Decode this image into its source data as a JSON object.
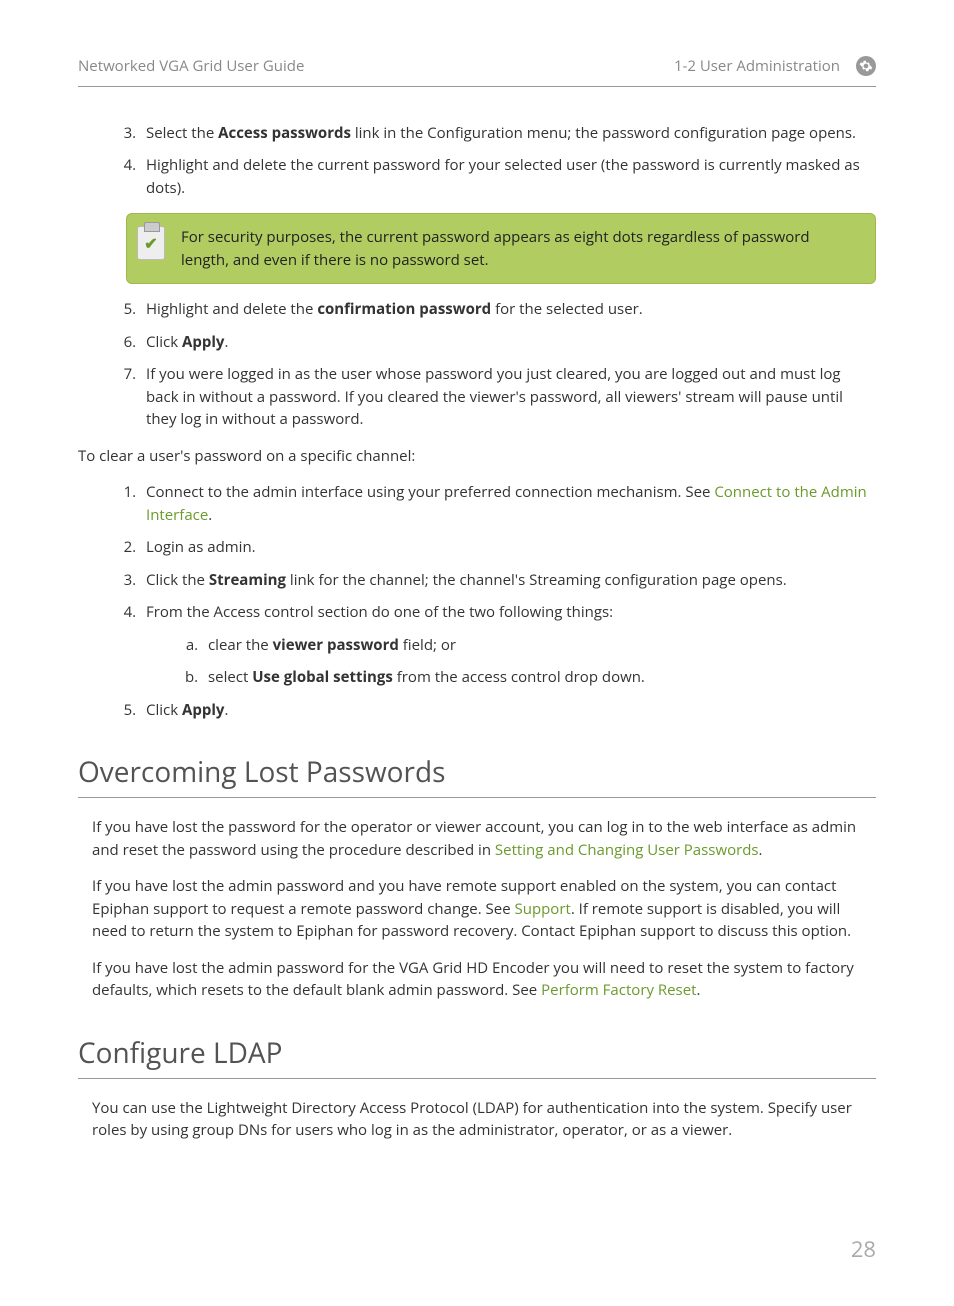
{
  "header": {
    "left": "Networked VGA Grid User Guide",
    "right": "1-2 User Administration"
  },
  "list1": {
    "item3_a": "Select the ",
    "item3_bold": "Access passwords",
    "item3_b": " link in the Configuration menu; the password configuration page opens.",
    "item4": "Highlight and delete the current password for your selected user (the password is currently masked as dots)."
  },
  "callout1": "For security purposes, the current password appears as eight dots regardless of password length, and even if there is no password set.",
  "list2": {
    "item5_a": "Highlight and delete the ",
    "item5_bold": "confirmation password",
    "item5_b": " for the selected user.",
    "item6_a": "Click ",
    "item6_bold": "Apply",
    "item6_b": ".",
    "item7": "If you were logged in as the user whose password you just cleared, you are logged out and must log back in without a password. If you cleared the viewer's password, all viewers' stream will pause until they log in without a password."
  },
  "para_clear": "To clear a user's password on a specific channel:",
  "list3": {
    "item1_a": "Connect to the admin interface using your preferred connection mechanism. See ",
    "item1_link": "Connect to the Admin Interface",
    "item1_b": ".",
    "item2": "Login as admin.",
    "item3_a": "Click the ",
    "item3_bold": "Streaming",
    "item3_b": " link for the channel; the channel's Streaming configuration page opens.",
    "item4": "From the Access control section do one of the two following things:",
    "item4a_a": "clear the ",
    "item4a_bold": "viewer password",
    "item4a_b": " field; or",
    "item4b_a": "select ",
    "item4b_bold": "Use global settings",
    "item4b_b": " from the access control drop down.",
    "item5_a": "Click ",
    "item5_bold": "Apply",
    "item5_b": "."
  },
  "section_overcoming": {
    "title": "Overcoming Lost Passwords",
    "p1_a": "If you have lost the password for the operator or viewer account, you can log in to the web interface as admin and reset the password using the procedure described in ",
    "p1_link": "Setting and Changing User Passwords",
    "p1_b": ".",
    "p2_a": "If you have lost the admin password and you have remote support enabled on the system, you can contact Epiphan support to request a remote password change. See ",
    "p2_link": "Support",
    "p2_b": ". If remote support is disabled, you will need to return the system to Epiphan for password recovery. Contact Epiphan support to discuss this option.",
    "p3_a": "If you have lost the admin password for the VGA Grid HD Encoder you will need to reset the system to factory defaults, which resets to the default blank admin password. See ",
    "p3_link": "Perform Factory Reset",
    "p3_b": "."
  },
  "section_ldap": {
    "title": "Configure LDAP",
    "p1": "You can use the Lightweight Directory Access Protocol (LDAP) for authentication into the system. Specify user roles by using group DNs for users who log in as the administrator, operator, or as a viewer."
  },
  "page_number": "28"
}
